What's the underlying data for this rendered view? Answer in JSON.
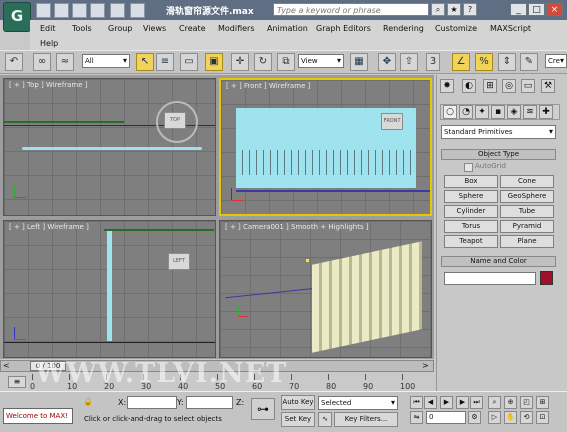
{
  "app": {
    "title": "滑轨窗帘源文件.max",
    "logo_icon": "max-logo-icon",
    "search_placeholder": "Type a keyword or phrase"
  },
  "menu": [
    "Edit",
    "Tools",
    "Group",
    "Views",
    "Create",
    "Modifiers",
    "Animation",
    "Graph Editors",
    "Rendering",
    "Customize",
    "MAXScript",
    "Help"
  ],
  "toolbar": {
    "filter": "All",
    "refcoord": "View",
    "snap_label": "3",
    "cre_label": "Cre"
  },
  "viewports": {
    "top": "[ + ] Top ] Wireframe ]",
    "front": "[ + ] Front ] Wireframe ]",
    "left": "[ + ] Left ] Wireframe ]",
    "camera": "[ + ] Camera001 ] Smooth + Highlights ]",
    "cube_top": "TOP",
    "cube_front": "FRONT",
    "cube_left": "LEFT"
  },
  "panel": {
    "category": "Standard Primitives",
    "object_type_title": "Object Type",
    "autogrid": "AutoGrid",
    "objects": [
      "Box",
      "Cone",
      "Sphere",
      "GeoSphere",
      "Cylinder",
      "Tube",
      "Torus",
      "Pyramid",
      "Teapot",
      "Plane"
    ],
    "name_color_title": "Name and Color",
    "object_color": "#a0102a"
  },
  "timeline": {
    "frame": "0 / 100",
    "ticks": [
      "0",
      "10",
      "20",
      "30",
      "40",
      "50",
      "60",
      "70",
      "80",
      "90",
      "100"
    ]
  },
  "watermark": "WWW.TLVI.NET",
  "status": {
    "welcome": "Welcome to MAX!",
    "prompt": "Click or click-and-drag to select objects",
    "x_label": "X:",
    "y_label": "Y:",
    "z_label": "Z:",
    "auto_key": "Auto Key",
    "set_key": "Set Key",
    "selected": "Selected",
    "key_filters": "Key Filters...",
    "frame_value": "0"
  }
}
